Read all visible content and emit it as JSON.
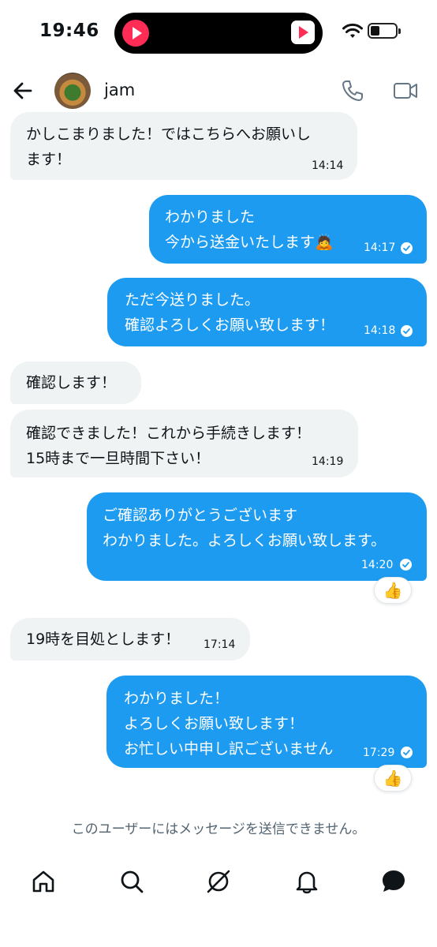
{
  "status_bar": {
    "time": "19:46"
  },
  "header": {
    "name": "jam"
  },
  "messages": [
    {
      "lines": [
        "かしこまりました！ではこちらへお願いし",
        "ます！"
      ],
      "time": "14:14"
    },
    {
      "lines": [
        "わかりました",
        "今から送金いたします🙇"
      ],
      "time": "14:17"
    },
    {
      "lines": [
        "ただ今送りました。",
        "確認よろしくお願い致します！"
      ],
      "time": "14:18"
    },
    {
      "lines": [
        "確認します！"
      ]
    },
    {
      "lines": [
        "確認できました！これから手続きします！",
        "15時まで一旦時間下さい！"
      ],
      "time": "14:19"
    },
    {
      "lines": [
        "ご確認ありがとうございます",
        "わかりました。よろしくお願い致します。"
      ],
      "time": "14:20",
      "reaction": "👍"
    },
    {
      "lines": [
        "19時を目処とします！"
      ],
      "time": "17:14"
    },
    {
      "lines": [
        "わかりました！",
        "よろしくお願い致します！",
        "お忙しい中申し訳ございません"
      ],
      "time": "17:29",
      "reaction": "👍"
    }
  ],
  "notice": "このユーザーにはメッセージを送信できません。",
  "colors": {
    "accent": "#1d9bf0",
    "incoming_bg": "#eff3f4",
    "notice_text": "#536471"
  },
  "icons": [
    "back-arrow-icon",
    "phone-icon",
    "video-icon",
    "read-check-icon",
    "home-icon",
    "search-icon",
    "grok-icon",
    "bell-icon",
    "messages-icon"
  ]
}
